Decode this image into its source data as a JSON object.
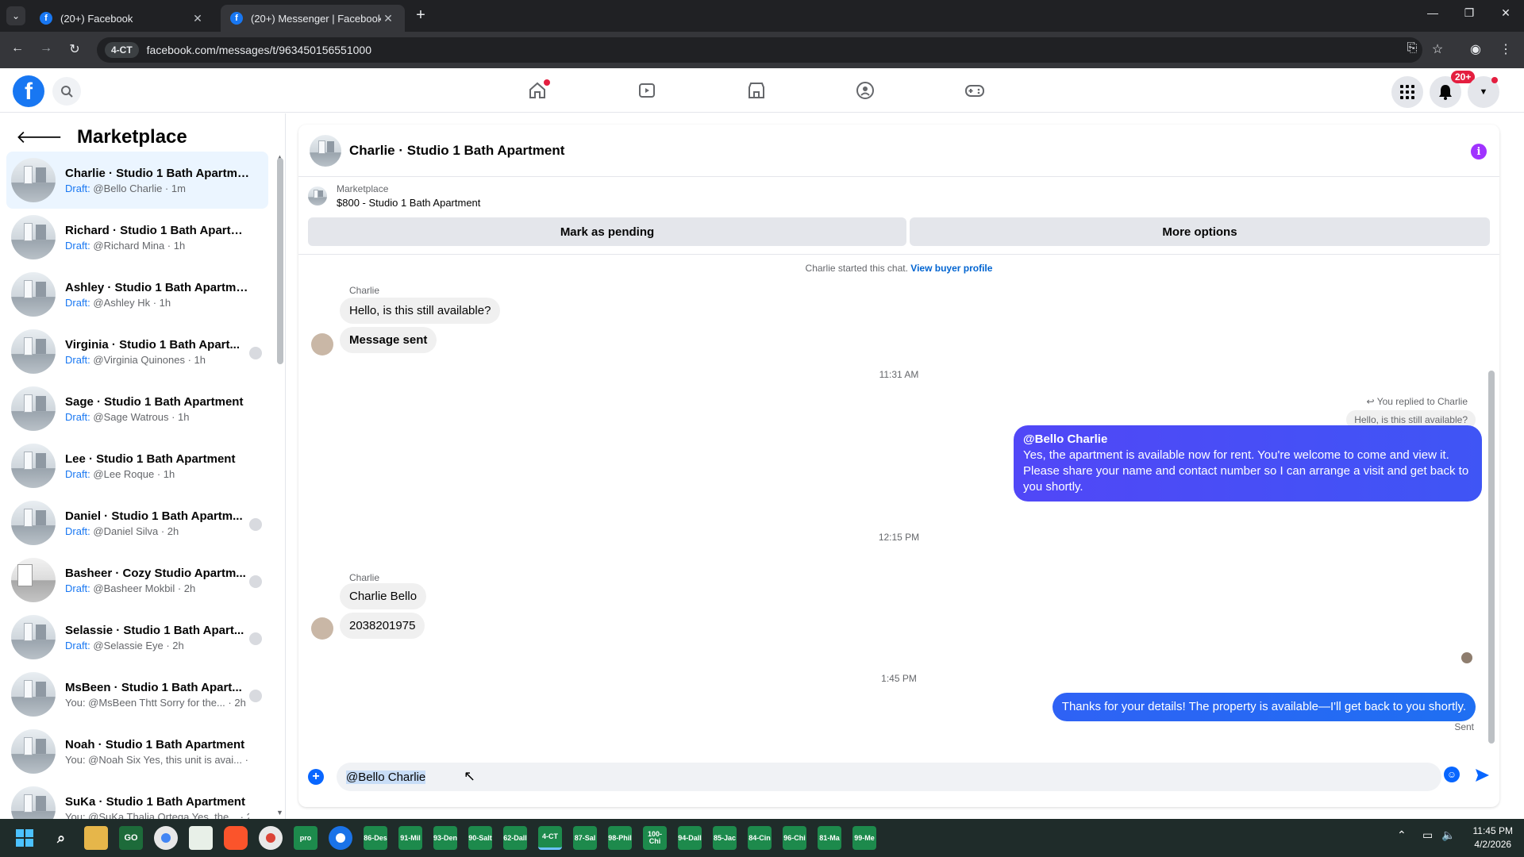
{
  "browser": {
    "tabs": [
      {
        "title": "(20+) Facebook",
        "active": false
      },
      {
        "title": "(20+) Messenger | Facebook",
        "active": true
      }
    ],
    "site_chip": "4-CT",
    "url": "facebook.com/messages/t/963450156551000"
  },
  "fbnav": {
    "notification_badge": "20+",
    "center_icons": [
      "home-icon",
      "video-icon",
      "marketplace-icon",
      "groups-icon",
      "gaming-icon"
    ]
  },
  "sidebar": {
    "title": "Marketplace",
    "draft_prefix": "Draft:",
    "conversations": [
      {
        "name": "Charlie · Studio 1 Bath Apartment",
        "sub": " @Bello Charlie · 1m",
        "draft": true,
        "selected": true,
        "mini": false
      },
      {
        "name": "Richard · Studio 1 Bath Apartment",
        "sub": " @Richard Mina · 1h",
        "draft": true,
        "selected": false,
        "mini": false
      },
      {
        "name": "Ashley · Studio 1 Bath Apartment",
        "sub": " @Ashley Hk · 1h",
        "draft": true,
        "selected": false,
        "mini": false
      },
      {
        "name": "Virginia · Studio 1 Bath Apart...",
        "sub": " @Virginia Quinones · 1h",
        "draft": true,
        "selected": false,
        "mini": true
      },
      {
        "name": "Sage · Studio 1 Bath Apartment",
        "sub": " @Sage Watrous · 1h",
        "draft": true,
        "selected": false,
        "mini": false
      },
      {
        "name": "Lee · Studio 1 Bath Apartment",
        "sub": " @Lee Roque · 1h",
        "draft": true,
        "selected": false,
        "mini": false
      },
      {
        "name": "Daniel · Studio 1 Bath Apartm...",
        "sub": " @Daniel Silva · 2h",
        "draft": true,
        "selected": false,
        "mini": true
      },
      {
        "name": "Basheer · Cozy Studio Apartm...",
        "sub": " @Basheer Mokbil · 2h",
        "draft": true,
        "selected": false,
        "mini": true
      },
      {
        "name": "Selassie · Studio 1 Bath Apart...",
        "sub": " @Selassie Eye · 2h",
        "draft": true,
        "selected": false,
        "mini": true
      },
      {
        "name": "MsBeen · Studio 1 Bath Apart...",
        "sub": "You: @MsBeen Thtt Sorry for the... · 2h",
        "draft": false,
        "selected": false,
        "mini": true
      },
      {
        "name": "Noah · Studio 1 Bath Apartment",
        "sub": "You: @Noah Six Yes, this unit is avai... · 2h",
        "draft": false,
        "selected": false,
        "mini": false
      },
      {
        "name": "SuKa · Studio 1 Bath Apartment",
        "sub": "You: @SuKa Thalia Ortega Yes, the... · 2h",
        "draft": false,
        "selected": false,
        "mini": false
      }
    ]
  },
  "chat": {
    "title": "Charlie · Studio 1 Bath Apartment",
    "listing_label": "Marketplace",
    "listing_price": "$800 - Studio 1 Bath Apartment",
    "mark_pending": "Mark as pending",
    "more_options": "More options",
    "started_text": "Charlie started this chat.",
    "view_profile": "View buyer profile",
    "sender": "Charlie",
    "msg1": "Hello, is this still available?",
    "msg2": "Message sent",
    "time1": "11:31 AM",
    "reply_note": "You replied to Charlie",
    "reply_quote": "Hello, is this still available?",
    "out1_mention": "@Bello Charlie",
    "out1_text": "Yes, the apartment is available now for rent. You're welcome to come and view it. Please share your name and contact number so I can arrange a visit and get back to you shortly.",
    "time2": "12:15 PM",
    "msg3": "Charlie Bello",
    "msg4": "2038201975",
    "time3": "1:45 PM",
    "out2_text": "Thanks for your details! The property is available—I'll get back to you shortly.",
    "sent_label": "Sent",
    "input_value": "@Bello Charlie"
  },
  "taskbar": {
    "apps": [
      "86-Des",
      "91-Mil",
      "93-Den",
      "90-Salt",
      "62-Dall",
      "4-CT",
      "87-Sal",
      "98-Phil",
      "100-Chi",
      "94-Dall",
      "85-Jac",
      "84-Cin",
      "96-Chi",
      "81-Ma",
      "99-Me"
    ],
    "clock_time": "11:45 PM",
    "clock_date": "4/2/2026"
  }
}
